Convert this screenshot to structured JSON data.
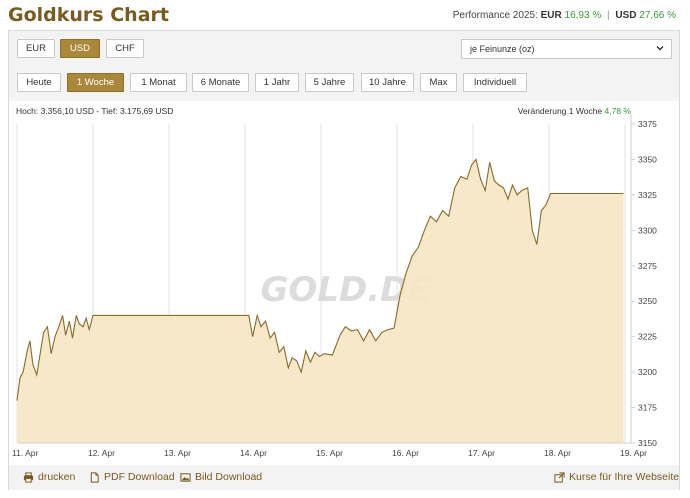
{
  "header": {
    "title": "Goldkurs Chart",
    "performance_label": "Performance 2025:",
    "perf_eur_cur": "EUR",
    "perf_eur_val": "16,93 %",
    "perf_usd_cur": "USD",
    "perf_usd_val": "27,66 %",
    "separator": "|"
  },
  "currencies": [
    {
      "label": "EUR",
      "active": false
    },
    {
      "label": "USD",
      "active": true
    },
    {
      "label": "CHF",
      "active": false
    }
  ],
  "unit_select": {
    "value": "je Feinunze (oz)"
  },
  "periods": [
    {
      "label": "Heute",
      "active": false
    },
    {
      "label": "1 Woche",
      "active": true
    },
    {
      "label": "1 Monat",
      "active": false
    },
    {
      "label": "6 Monate",
      "active": false
    },
    {
      "label": "1 Jahr",
      "active": false
    },
    {
      "label": "5 Jahre",
      "active": false
    },
    {
      "label": "10 Jahre",
      "active": false
    },
    {
      "label": "Max",
      "active": false
    },
    {
      "label": "Individuell",
      "active": false
    }
  ],
  "stats": {
    "high_low": "Hoch: 3.356,10 USD - Tief: 3.175,69 USD",
    "change_label": "Veränderung 1 Woche",
    "change_value": "4,78 %"
  },
  "watermark": {
    "text": "GOLD.DE"
  },
  "footer": {
    "print": "drucken",
    "pdf": "PDF Download",
    "image": "Bild Download",
    "prices": "Kurse für Ihre Webseite"
  },
  "colors": {
    "accent": "#a9873b",
    "line": "#8a6a2a",
    "fill": "#f5e6c2",
    "positive": "#3a9a3a"
  },
  "chart_data": {
    "type": "area",
    "title": "",
    "xlabel": "",
    "ylabel": "",
    "ylim": [
      3150,
      3375
    ],
    "y_ticks": [
      3150,
      3175,
      3200,
      3225,
      3250,
      3275,
      3300,
      3325,
      3350,
      3375
    ],
    "x_ticks": [
      {
        "label": "11. Apr",
        "x": 0
      },
      {
        "label": "12. Apr",
        "x": 1
      },
      {
        "label": "13. Apr",
        "x": 2
      },
      {
        "label": "14. Apr",
        "x": 3
      },
      {
        "label": "15. Apr",
        "x": 4
      },
      {
        "label": "16. Apr",
        "x": 5
      },
      {
        "label": "17. Apr",
        "x": 6
      },
      {
        "label": "18. Apr",
        "x": 7
      },
      {
        "label": "19. Apr",
        "x": 8
      }
    ],
    "grid": true,
    "series": [
      {
        "values": [
          [
            0.0,
            3180
          ],
          [
            0.04,
            3196
          ],
          [
            0.08,
            3200
          ],
          [
            0.13,
            3214
          ],
          [
            0.17,
            3222
          ],
          [
            0.21,
            3205
          ],
          [
            0.26,
            3198
          ],
          [
            0.31,
            3215
          ],
          [
            0.35,
            3228
          ],
          [
            0.4,
            3232
          ],
          [
            0.45,
            3213
          ],
          [
            0.5,
            3225
          ],
          [
            0.55,
            3232
          ],
          [
            0.6,
            3240
          ],
          [
            0.64,
            3226
          ],
          [
            0.69,
            3236
          ],
          [
            0.73,
            3224
          ],
          [
            0.78,
            3240
          ],
          [
            0.82,
            3234
          ],
          [
            0.87,
            3232
          ],
          [
            0.91,
            3238
          ],
          [
            0.95,
            3230
          ],
          [
            1.0,
            3240
          ],
          [
            2.0,
            3240
          ],
          [
            3.0,
            3240
          ],
          [
            3.05,
            3240
          ],
          [
            3.1,
            3225
          ],
          [
            3.16,
            3240
          ],
          [
            3.21,
            3232
          ],
          [
            3.27,
            3236
          ],
          [
            3.33,
            3224
          ],
          [
            3.39,
            3228
          ],
          [
            3.45,
            3214
          ],
          [
            3.51,
            3218
          ],
          [
            3.57,
            3203
          ],
          [
            3.62,
            3210
          ],
          [
            3.68,
            3208
          ],
          [
            3.74,
            3200
          ],
          [
            3.8,
            3215
          ],
          [
            3.86,
            3207
          ],
          [
            3.92,
            3214
          ],
          [
            3.98,
            3211
          ],
          [
            4.04,
            3213
          ],
          [
            4.15,
            3212
          ],
          [
            4.25,
            3226
          ],
          [
            4.32,
            3232
          ],
          [
            4.4,
            3229
          ],
          [
            4.48,
            3230
          ],
          [
            4.56,
            3222
          ],
          [
            4.64,
            3230
          ],
          [
            4.72,
            3222
          ],
          [
            4.8,
            3228
          ],
          [
            4.88,
            3230
          ],
          [
            4.96,
            3231
          ],
          [
            5.04,
            3254
          ],
          [
            5.12,
            3270
          ],
          [
            5.2,
            3282
          ],
          [
            5.28,
            3288
          ],
          [
            5.36,
            3300
          ],
          [
            5.44,
            3310
          ],
          [
            5.52,
            3306
          ],
          [
            5.6,
            3314
          ],
          [
            5.68,
            3310
          ],
          [
            5.76,
            3330
          ],
          [
            5.84,
            3338
          ],
          [
            5.92,
            3336
          ],
          [
            5.98,
            3346
          ],
          [
            6.04,
            3350
          ],
          [
            6.1,
            3336
          ],
          [
            6.16,
            3328
          ],
          [
            6.22,
            3348
          ],
          [
            6.28,
            3335
          ],
          [
            6.34,
            3332
          ],
          [
            6.4,
            3330
          ],
          [
            6.46,
            3322
          ],
          [
            6.52,
            3332
          ],
          [
            6.58,
            3325
          ],
          [
            6.64,
            3328
          ],
          [
            6.72,
            3330
          ],
          [
            6.78,
            3300
          ],
          [
            6.84,
            3290
          ],
          [
            6.9,
            3314
          ],
          [
            6.96,
            3318
          ],
          [
            7.02,
            3326
          ],
          [
            7.1,
            3326
          ],
          [
            7.5,
            3326
          ],
          [
            7.98,
            3326
          ]
        ]
      }
    ]
  }
}
